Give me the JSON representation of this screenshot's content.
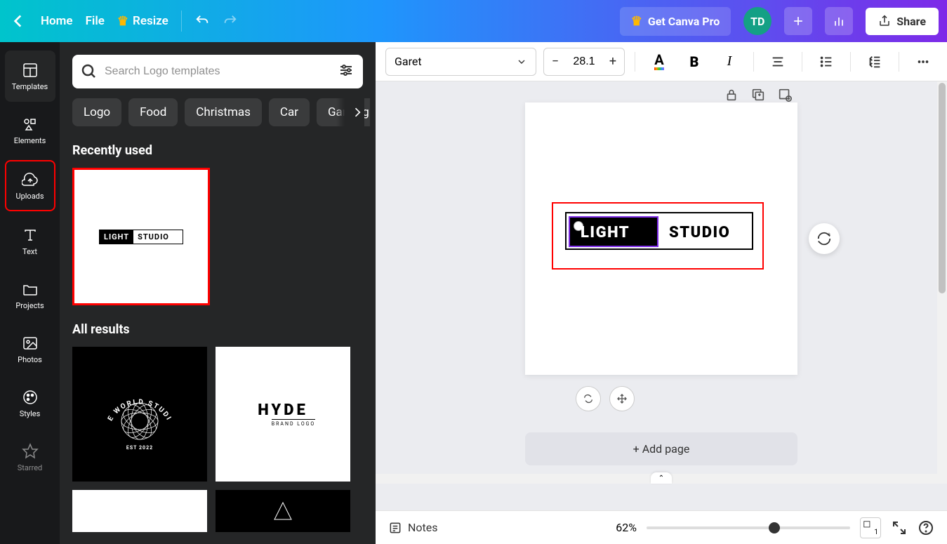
{
  "topbar": {
    "home": "Home",
    "file": "File",
    "resize": "Resize",
    "pro": "Get Canva Pro",
    "avatar": "TD",
    "share": "Share"
  },
  "nav": {
    "templates": "Templates",
    "elements": "Elements",
    "uploads": "Uploads",
    "text": "Text",
    "projects": "Projects",
    "photos": "Photos",
    "styles": "Styles",
    "starred": "Starred"
  },
  "panel": {
    "search_placeholder": "Search Logo templates",
    "chips": [
      "Logo",
      "Food",
      "Christmas",
      "Car",
      "Gaming"
    ],
    "recent_title": "Recently used",
    "allresults_title": "All results",
    "recent_logo_left": "LIGHT",
    "recent_logo_right": "STUDIO",
    "result_world_top": "THE WORLD STUDIOS",
    "result_world_est": "EST 2022",
    "result_hyde": "HYDE",
    "result_hyde_sub": "BRAND LOGO"
  },
  "toolbar": {
    "font": "Garet",
    "fontsize": "28.1"
  },
  "canvas": {
    "logo_light": "LIGHT",
    "logo_studio": "STUDIO",
    "addpage": "+ Add page"
  },
  "bottom": {
    "notes": "Notes",
    "zoom": "62%",
    "page": "1"
  }
}
